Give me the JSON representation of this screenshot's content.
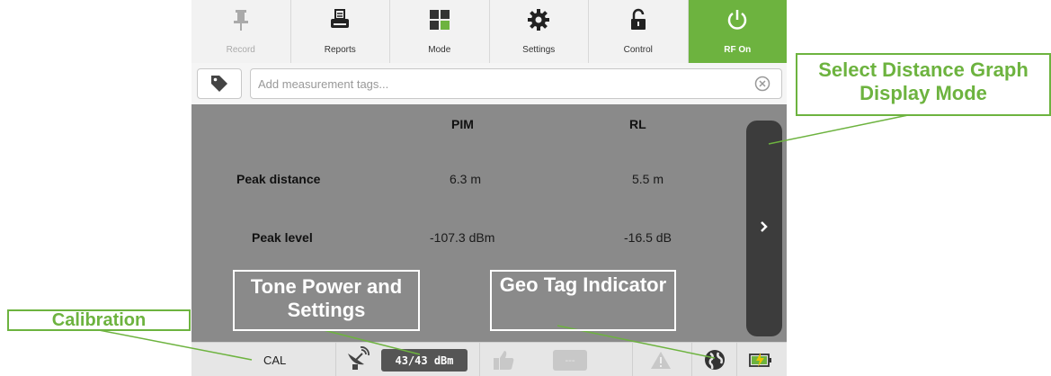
{
  "toolbar": {
    "items": [
      {
        "label": "Record",
        "icon": "pin-icon",
        "state": "disabled"
      },
      {
        "label": "Reports",
        "icon": "printer-icon",
        "state": "normal"
      },
      {
        "label": "Mode",
        "icon": "grid-icon",
        "state": "normal"
      },
      {
        "label": "Settings",
        "icon": "gear-icon",
        "state": "normal"
      },
      {
        "label": "Control",
        "icon": "unlock-icon",
        "state": "normal"
      },
      {
        "label": "RF On",
        "icon": "power-icon",
        "state": "active"
      }
    ]
  },
  "tags": {
    "placeholder": "Add measurement tags..."
  },
  "results": {
    "columns": [
      "PIM",
      "RL"
    ],
    "rows": [
      {
        "label": "Peak distance",
        "values": [
          "6.3 m",
          "5.5 m"
        ]
      },
      {
        "label": "Peak level",
        "values": [
          "-107.3 dBm",
          "-16.5 dB"
        ]
      }
    ]
  },
  "status": {
    "cal": "CAL",
    "tone_power": "43/43 dBm",
    "dash": "---"
  },
  "callouts": {
    "select_mode": "Select Distance Graph Display Mode",
    "tone_power": "Tone Power and Settings",
    "geo_tag": "Geo Tag Indicator",
    "calibration": "Calibration"
  },
  "colors": {
    "accent_green": "#6db33f",
    "panel_gray": "#8a8a8a",
    "scroll_dark": "#3c3c3c"
  }
}
